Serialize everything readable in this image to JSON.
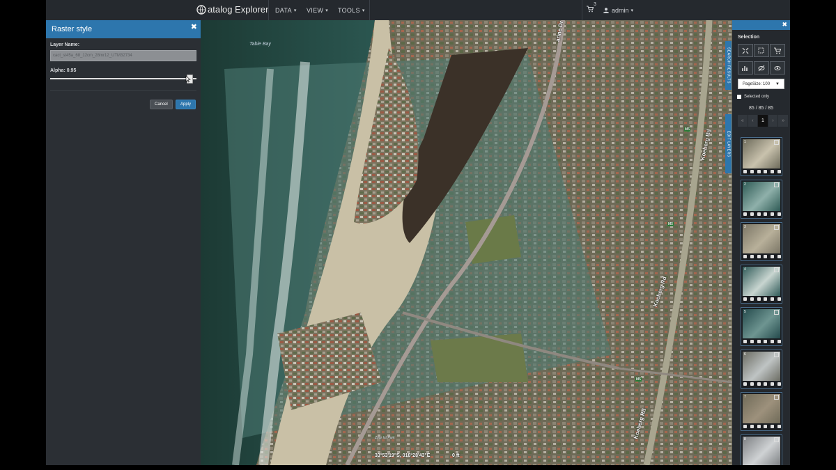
{
  "navbar": {
    "brand": "atalog Explorer",
    "menus": [
      {
        "label": "DATA"
      },
      {
        "label": "VIEW"
      },
      {
        "label": "TOOLS"
      }
    ],
    "cart_count": "3",
    "user": "admin"
  },
  "raster_style": {
    "title": "Raster style",
    "layer_name_label": "Layer Name:",
    "layer_name_value": "cact_st45a_68_12cm_28mr12_UTM32734",
    "alpha_label": "Alpha: 0.95",
    "alpha_value": 0.95,
    "cancel_label": "Cancel",
    "apply_label": "Apply"
  },
  "map": {
    "labels": {
      "table_bay": "Table Bay",
      "zoar": "Zoar Ist Park"
    },
    "roads": {
      "marine": "arine Dr",
      "koeberg1": "Koeberg Rd",
      "koeberg2": "Koeberg Rd",
      "koeberg3": "Koeberg Rd",
      "m5_a": "M5",
      "m5_b": "M5",
      "m5_c": "M5"
    },
    "coords": "33°53'19\"S, 018°28'43\"E",
    "scale": "0 ft"
  },
  "selection": {
    "title": "Selection",
    "pagesize": "PageSize: 100",
    "selected_only": "Selected only",
    "count": "85 / 85 / 85",
    "page": "1",
    "side_tab_1": "SEARCH RESULTS",
    "side_tab_2": "EDIT LAYERS",
    "thumbnails": [
      {
        "num": "1"
      },
      {
        "num": "2"
      },
      {
        "num": "3"
      },
      {
        "num": "4"
      },
      {
        "num": "5"
      },
      {
        "num": "6"
      },
      {
        "num": "7"
      },
      {
        "num": "8"
      }
    ]
  }
}
